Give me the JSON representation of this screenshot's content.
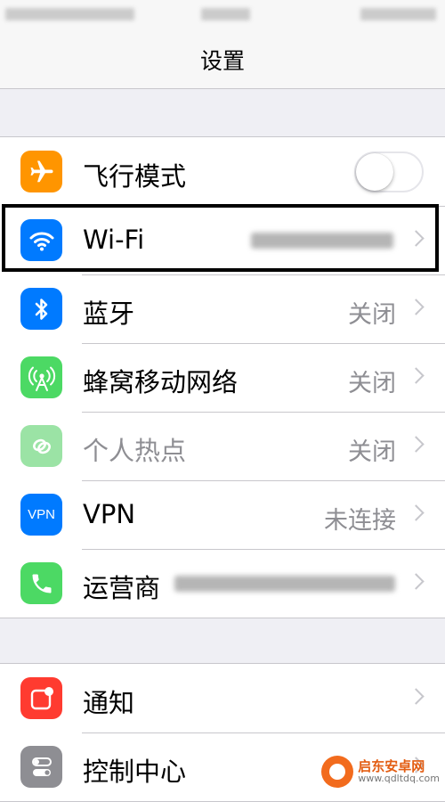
{
  "nav": {
    "title": "设置"
  },
  "group1": [
    {
      "key": "airplane",
      "label": "飞行模式",
      "color": "#ff9500",
      "icon": "airplane-icon",
      "toggle_on": false
    },
    {
      "key": "wifi",
      "label": "Wi-Fi",
      "color": "#007aff",
      "icon": "wifi-icon",
      "value": ""
    },
    {
      "key": "bluetooth",
      "label": "蓝牙",
      "color": "#007aff",
      "icon": "bluetooth-icon",
      "value": "关闭"
    },
    {
      "key": "cellular",
      "label": "蜂窝移动网络",
      "color": "#4cd964",
      "icon": "cellular-antenna-icon",
      "value": "关闭"
    },
    {
      "key": "hotspot",
      "label": "个人热点",
      "color": "#9be3a5",
      "icon": "hotspot-link-icon",
      "value": "关闭"
    },
    {
      "key": "vpn",
      "label": "VPN",
      "color": "#007aff",
      "icon": "vpn-icon",
      "icon_text": "VPN",
      "value": "未连接"
    },
    {
      "key": "carrier",
      "label": "运营商",
      "color": "#4cd964",
      "icon": "phone-icon",
      "value": ""
    }
  ],
  "group2": [
    {
      "key": "notifications",
      "label": "通知",
      "color": "#ff3b30",
      "icon": "notification-icon"
    },
    {
      "key": "control-center",
      "label": "控制中心",
      "color": "#8e8e93",
      "icon": "control-center-icon"
    }
  ],
  "watermark": {
    "name": "启东安卓网",
    "url": "www.qdltdq.com"
  }
}
